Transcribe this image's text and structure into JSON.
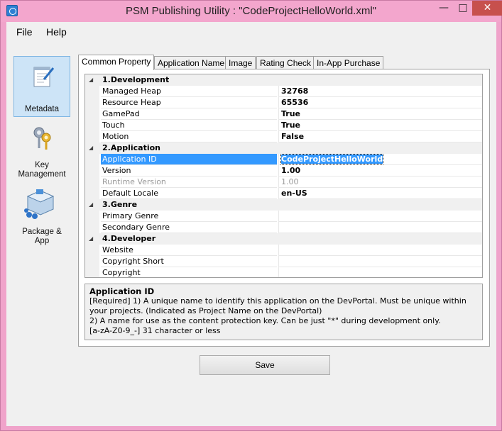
{
  "window": {
    "title": "PSM Publishing Utility : \"CodeProjectHelloWorld.xml\""
  },
  "menu": [
    "File",
    "Help"
  ],
  "sidebar": [
    {
      "label": "Metadata",
      "icon": "notepad-pencil-icon",
      "active": true
    },
    {
      "label": "Key Management",
      "icon": "keys-icon",
      "active": false
    },
    {
      "label": "Package & App",
      "icon": "package-icon",
      "active": false
    }
  ],
  "tabs": [
    {
      "label": "Common Property",
      "active": true
    },
    {
      "label": "Application Name"
    },
    {
      "label": "Image"
    },
    {
      "label": "Rating Check"
    },
    {
      "label": "In-App Purchase"
    }
  ],
  "properties": {
    "categories": [
      {
        "label": "1.Development",
        "rows": [
          {
            "name": "Managed Heap",
            "value": "32768"
          },
          {
            "name": "Resource Heap",
            "value": "65536"
          },
          {
            "name": "GamePad",
            "value": "True"
          },
          {
            "name": "Touch",
            "value": "True"
          },
          {
            "name": "Motion",
            "value": "False"
          }
        ]
      },
      {
        "label": "2.Application",
        "rows": [
          {
            "name": "Application ID",
            "value": "CodeProjectHelloWorld",
            "selected": true
          },
          {
            "name": "Version",
            "value": "1.00"
          },
          {
            "name": "Runtime Version",
            "value": "1.00",
            "disabled": true
          },
          {
            "name": "Default Locale",
            "value": "en-US"
          }
        ]
      },
      {
        "label": "3.Genre",
        "rows": [
          {
            "name": "Primary Genre",
            "value": ""
          },
          {
            "name": "Secondary Genre",
            "value": ""
          }
        ]
      },
      {
        "label": "4.Developer",
        "rows": [
          {
            "name": "Website",
            "value": ""
          },
          {
            "name": "Copyright Short",
            "value": ""
          },
          {
            "name": "Copyright",
            "value": ""
          }
        ]
      }
    ]
  },
  "description": {
    "title": "Application ID",
    "line1": "[Required] 1) A unique name to identify this application on the DevPortal. Must be unique within your projects. (Indicated as Project Name on the DevPortal)",
    "line2": "2) A name for use as the content protection key. Can be just \"*\" during development only.",
    "line3": "[a-zA-Z0-9_-] 31 character or less"
  },
  "save_label": "Save"
}
